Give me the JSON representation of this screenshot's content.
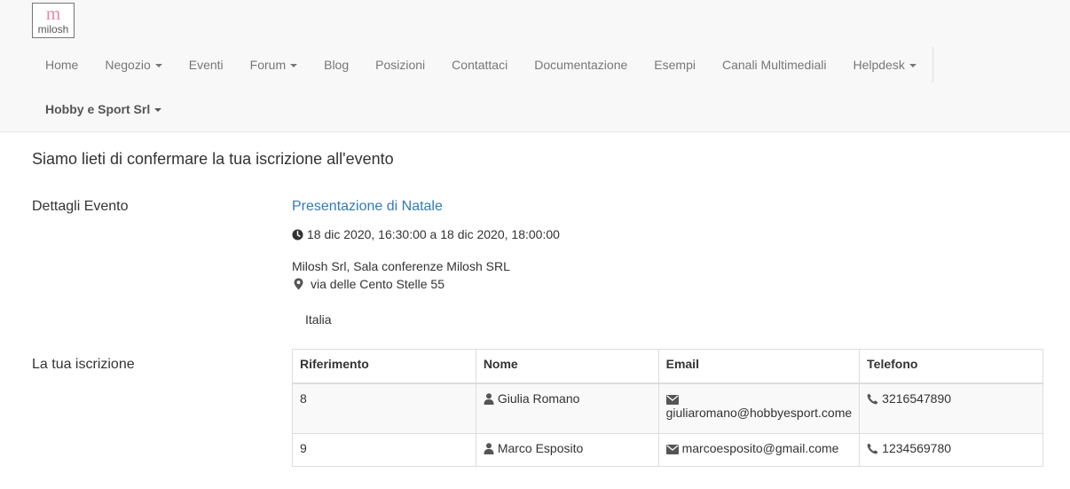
{
  "logo": {
    "mark": "m",
    "word": "milosh"
  },
  "nav": {
    "items": [
      {
        "label": "Home",
        "dropdown": false
      },
      {
        "label": "Negozio",
        "dropdown": true
      },
      {
        "label": "Eventi",
        "dropdown": false
      },
      {
        "label": "Forum",
        "dropdown": true
      },
      {
        "label": "Blog",
        "dropdown": false
      },
      {
        "label": "Posizioni",
        "dropdown": false
      },
      {
        "label": "Contattaci",
        "dropdown": false
      },
      {
        "label": "Documentazione",
        "dropdown": false
      },
      {
        "label": "Esempi",
        "dropdown": false
      },
      {
        "label": "Canali Multimediali",
        "dropdown": false
      },
      {
        "label": "Helpdesk",
        "dropdown": true
      }
    ],
    "account": "Hobby e Sport Srl"
  },
  "page": {
    "confirmation": "Siamo lieti di confermare la tua iscrizione all'evento",
    "details_label": "Dettagli Evento",
    "event_title": "Presentazione di Natale",
    "datetime": "18 dic 2020, 16:30:00 a 18 dic 2020, 18:00:00",
    "venue": "Milosh Srl, Sala conferenze Milosh SRL",
    "street": "via delle Cento Stelle 55",
    "country": "Italia",
    "registration_label": "La tua iscrizione"
  },
  "table": {
    "headers": [
      "Riferimento",
      "Nome",
      "Email",
      "Telefono"
    ],
    "rows": [
      {
        "ref": "8",
        "name": "Giulia Romano",
        "email": "giuliaromano@hobbyesport.come",
        "phone": "3216547890"
      },
      {
        "ref": "9",
        "name": "Marco Esposito",
        "email": "marcoesposito@gmail.come",
        "phone": "1234569780"
      }
    ]
  },
  "colors": {
    "link": "#337ab7",
    "navbar_bg": "#f8f8f8",
    "nav_text": "#777777",
    "logo_accent": "#e98aa8"
  },
  "icons": [
    "clock-icon",
    "map-marker-icon",
    "user-icon",
    "envelope-icon",
    "phone-icon",
    "caret-down-icon"
  ]
}
